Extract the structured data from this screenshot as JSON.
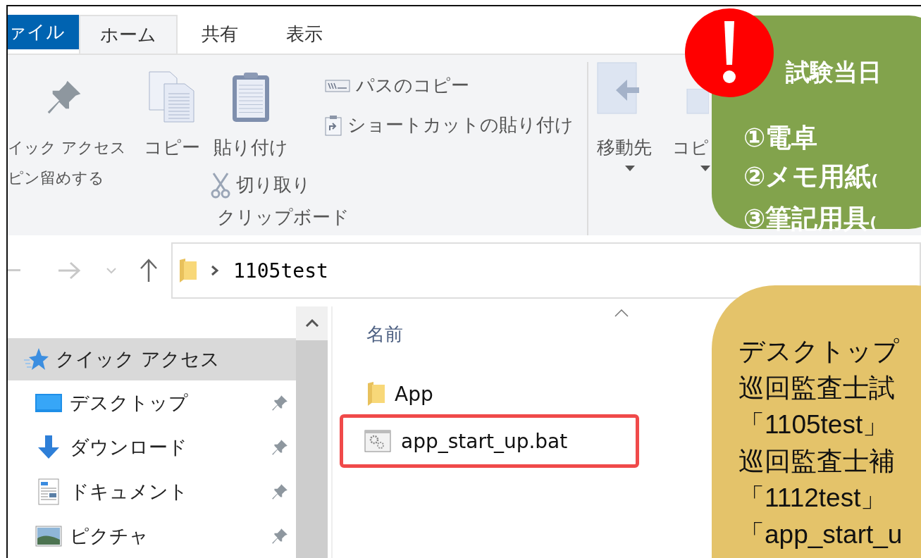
{
  "tabs": [
    {
      "label": "ァイル",
      "kind": "file",
      "selected": false
    },
    {
      "label": "ホーム",
      "kind": "tab",
      "selected": true
    },
    {
      "label": "共有",
      "kind": "tab",
      "selected": false
    },
    {
      "label": "表示",
      "kind": "tab",
      "selected": false
    }
  ],
  "clipboard_group": {
    "large_buttons": [
      {
        "kind": "pin",
        "label_lines": [
          "イック アクセス",
          "ピン留めする"
        ]
      },
      {
        "kind": "copy",
        "label": "コピー"
      },
      {
        "kind": "paste",
        "label": "貼り付け"
      }
    ],
    "cut_button": {
      "label": "切り取り"
    },
    "small_buttons": [
      {
        "kind": "path",
        "label": "パスのコピー"
      },
      {
        "kind": "shortcut",
        "label": "ショートカットの貼り付け"
      }
    ],
    "label": "クリップボード"
  },
  "organize_group": {
    "buttons": [
      {
        "kind": "move",
        "label": "移動先"
      },
      {
        "kind": "copy_to",
        "label": "コピ"
      }
    ]
  },
  "address_bar": {
    "path": "1105test"
  },
  "nav_pane": {
    "items": [
      {
        "label": "クイック アクセス",
        "kind": "quick",
        "selected": true,
        "children": [
          {
            "label": "デスクトップ",
            "kind": "desktop",
            "pinned": true
          },
          {
            "label": "ダウンロード",
            "kind": "download",
            "pinned": true
          },
          {
            "label": "ドキュメント",
            "kind": "document",
            "pinned": true
          },
          {
            "label": "ピクチャ",
            "kind": "picture",
            "pinned": true
          }
        ]
      }
    ]
  },
  "file_list": {
    "column": "名前",
    "files": [
      {
        "name": "App",
        "kind": "folder",
        "highlighted": false
      },
      {
        "name": "app_start_up.bat",
        "kind": "batch",
        "highlighted": true
      }
    ]
  },
  "notice": {
    "title": "試験当日",
    "items": [
      {
        "main": "①電卓"
      },
      {
        "main": "②メモ用紙",
        "note": "("
      },
      {
        "main": "③筆記用具",
        "note": "("
      }
    ]
  },
  "instructions": {
    "lines": [
      "デスクトップ",
      "巡回監査士試",
      "「1105test」",
      "巡回監査士補",
      "「1112test」",
      "「app_start_u"
    ]
  }
}
